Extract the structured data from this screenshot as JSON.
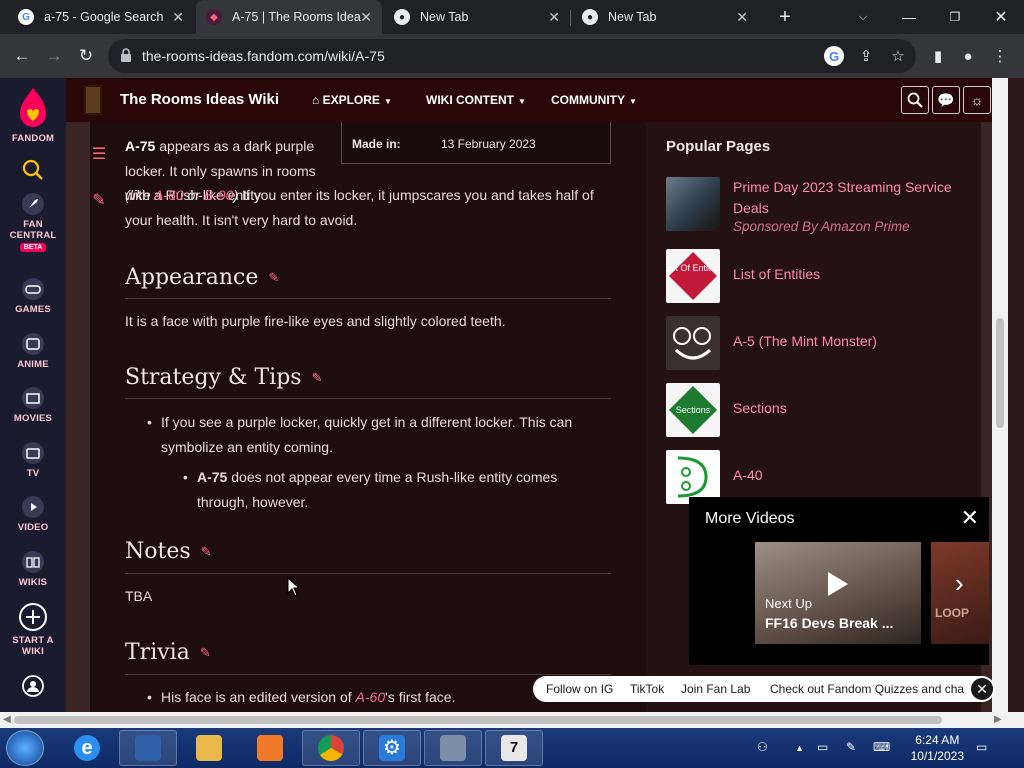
{
  "browser": {
    "tabs": [
      {
        "title": "a-75 - Google Search",
        "favicon": "google-icon"
      },
      {
        "title": "A-75 | The Rooms Idea",
        "favicon": "fandom-icon"
      },
      {
        "title": "New Tab",
        "favicon": "chrome-icon"
      },
      {
        "title": "New Tab",
        "favicon": "chrome-icon"
      }
    ],
    "url": "the-rooms-ideas.fandom.com/wiki/A-75"
  },
  "rail": {
    "brand": "FANDOM",
    "items": [
      {
        "label": "FAN CENTRAL",
        "badge": "BETA"
      },
      {
        "label": "GAMES"
      },
      {
        "label": "ANIME"
      },
      {
        "label": "MOVIES"
      },
      {
        "label": "TV"
      },
      {
        "label": "VIDEO"
      },
      {
        "label": "WIKIS"
      },
      {
        "label": "START A WIKI"
      }
    ]
  },
  "wiki_header": {
    "title": "The Rooms Ideas Wiki",
    "nav": [
      "EXPLORE",
      "WIKI CONTENT",
      "COMMUNITY"
    ]
  },
  "infobox": {
    "key": "Made in:",
    "value": "13 February 2023"
  },
  "article": {
    "intro_bold": "A-75",
    "intro_1": " appears as a dark purple locker. It only spawns in rooms with a Rush-like entity ",
    "intro_like": "(like ",
    "link_a60": "A-60",
    "intro_or": " or ",
    "link_b90": "B-90",
    "intro_close": ")",
    "intro_2": " If you enter its locker, it jumpscares you and takes half of your health. It isn't very hard to avoid.",
    "h_appearance": "Appearance",
    "appearance_text": "It is a face with purple fire-like eyes and slightly colored teeth.",
    "h_strategy": "Strategy & Tips",
    "tip_1": "If you see a purple locker, quickly get in a different locker. This can symbolize an entity coming.",
    "tip_2_bold": "A-75",
    "tip_2": " does not appear every time a Rush-like entity comes through, however.",
    "h_notes": "Notes",
    "notes_text": "TBA",
    "h_trivia": "Trivia",
    "trivia_1_pre": "His face is an edited version of ",
    "trivia_1_link": "A-60",
    "trivia_1_post": "'s first face."
  },
  "popular_pages": {
    "title": "Popular Pages",
    "items": [
      {
        "title": "Prime Day 2023 Streaming Service Deals",
        "sub": "Sponsored By Amazon Prime"
      },
      {
        "title": "List of Entities",
        "thumb_text": "List Of Entities"
      },
      {
        "title": "A-5 (The Mint Monster)"
      },
      {
        "title": "Sections",
        "thumb_text": "Sections"
      },
      {
        "title": "A-40"
      }
    ]
  },
  "videos": {
    "title": "More Videos",
    "next_up": "Next Up",
    "video_title": "FF16 Devs Break ...",
    "next_thumb_text": "LOOP"
  },
  "promo_bar": {
    "items": [
      "Follow on IG",
      "TikTok",
      "Join Fan Lab",
      "Check out Fandom Quizzes and cha"
    ]
  },
  "taskbar": {
    "time": "6:24 AM",
    "date": "10/1/2023"
  },
  "colors": {
    "fandom_pink": "#fa005a",
    "link": "#ff6b8b",
    "article_bg": "#1d0d0d",
    "header_bg": "#2a0707"
  }
}
